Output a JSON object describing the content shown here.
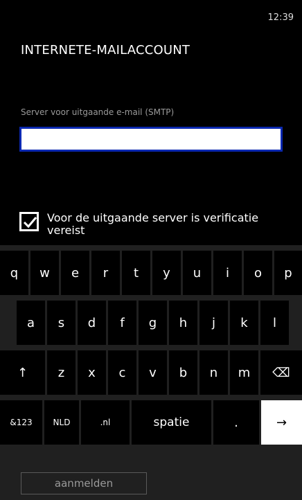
{
  "status": {
    "time": "12:39"
  },
  "page": {
    "title": "INTERNETE-MAILACCOUNT"
  },
  "form": {
    "smtp_label": "Server voor uitgaande e-mail (SMTP)",
    "smtp_value": "",
    "verification_label": "Voor de uitgaande server is verificatie vereist",
    "verification_checked": true
  },
  "keyboard": {
    "row1": [
      "q",
      "w",
      "e",
      "r",
      "t",
      "y",
      "u",
      "i",
      "o",
      "p"
    ],
    "row2": [
      "a",
      "s",
      "d",
      "f",
      "g",
      "h",
      "j",
      "k",
      "l"
    ],
    "row3": {
      "shift": "↑",
      "letters": [
        "z",
        "x",
        "c",
        "v",
        "b",
        "n",
        "m"
      ],
      "backspace": "⌫"
    },
    "row4": {
      "numbers": "&123",
      "language": "NLD",
      "domain": ".nl",
      "space": "spatie",
      "period": ".",
      "enter": "→"
    },
    "suggestion": "aanmelden"
  }
}
